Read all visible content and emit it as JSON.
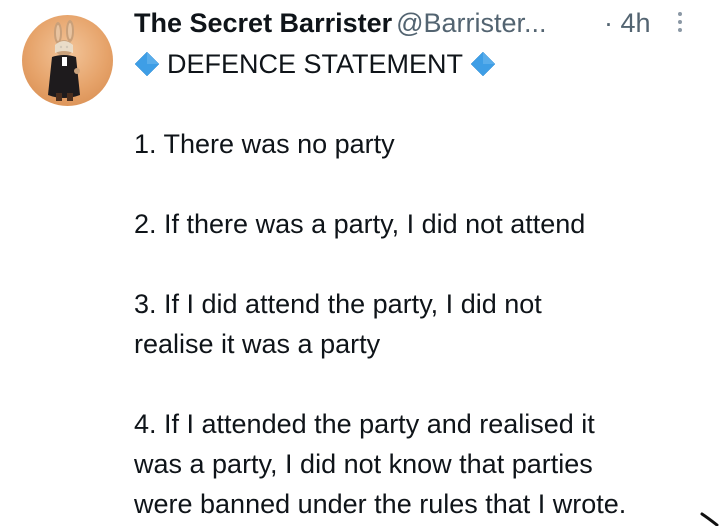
{
  "tweet": {
    "display_name": "The Secret Barrister",
    "handle": "@Barrister...",
    "time": "· 4h",
    "title": "DEFENCE STATEMENT",
    "lines": [
      "1. There was no party",
      "2. If there was a party, I did not attend",
      "3. If I did attend the party, I did not",
      "realise it was a party",
      "4. If I attended the party and realised it",
      "was a party, I did not know that parties",
      "were banned under the rules that I wrote."
    ]
  },
  "icons": {
    "diamond": "large-blue-diamond-icon",
    "more": "more-vertical-icon",
    "avatar": "rabbit-avatar"
  },
  "colors": {
    "text": "#0f1419",
    "secondary": "#536471",
    "diamond": "#3e9ee6"
  }
}
